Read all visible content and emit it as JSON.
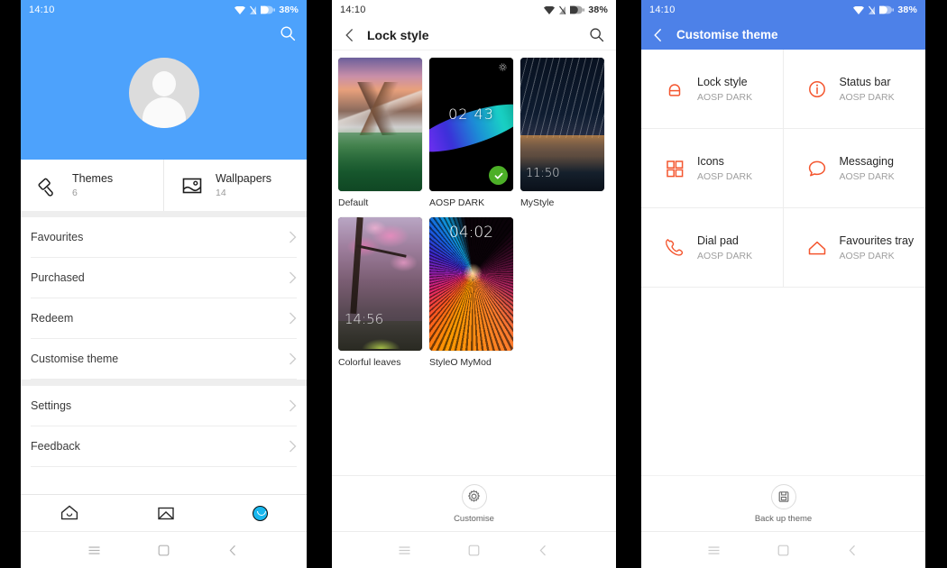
{
  "status_bar": {
    "time": "14:10",
    "battery": "38%",
    "icons": [
      "wifi-icon",
      "signal-off-icon",
      "battery-icon"
    ]
  },
  "colors": {
    "blue_header": "#4da2fc",
    "blue_appbar": "#4d81e8",
    "accent_orange": "#f4562f",
    "check_green": "#4caf27",
    "tab_active": "#18b7ee"
  },
  "phone1": {
    "search_icon": "search-icon",
    "avatar": "default-avatar",
    "quick": [
      {
        "icon": "paint-roller-icon",
        "title": "Themes",
        "count": "6"
      },
      {
        "icon": "image-icon",
        "title": "Wallpapers",
        "count": "14"
      }
    ],
    "menu_group1": [
      {
        "label": "Favourites"
      },
      {
        "label": "Purchased"
      },
      {
        "label": "Redeem"
      },
      {
        "label": "Customise theme"
      }
    ],
    "menu_group2": [
      {
        "label": "Settings"
      },
      {
        "label": "Feedback"
      }
    ],
    "tabs": [
      {
        "icon": "home-icon",
        "active": false
      },
      {
        "icon": "wallpaper-icon",
        "active": false
      },
      {
        "icon": "account-icon",
        "active": true
      }
    ]
  },
  "phone2": {
    "title": "Lock style",
    "back_icon": "back-chevron-icon",
    "search_icon": "search-icon",
    "items": [
      {
        "label": "Default",
        "art": "mountain",
        "selected": false,
        "clock": ""
      },
      {
        "label": "AOSP DARK",
        "art": "aosp",
        "selected": true,
        "clock": "02 43"
      },
      {
        "label": "MyStyle",
        "art": "startrails",
        "selected": false,
        "clock": "11:50"
      },
      {
        "label": "Colorful leaves",
        "art": "blossom",
        "selected": false,
        "clock": "14:56"
      },
      {
        "label": "StyleO MyMod",
        "art": "rays",
        "selected": false,
        "clock": "04:02"
      }
    ],
    "footer": {
      "icon": "gear-icon",
      "label": "Customise"
    }
  },
  "phone3": {
    "title": "Customise theme",
    "back_icon": "back-chevron-icon",
    "items": [
      {
        "icon": "lock-icon",
        "title": "Lock style",
        "sub": "AOSP DARK"
      },
      {
        "icon": "info-icon",
        "title": "Status bar",
        "sub": "AOSP DARK"
      },
      {
        "icon": "grid-icon",
        "title": "Icons",
        "sub": "AOSP DARK"
      },
      {
        "icon": "message-icon",
        "title": "Messaging",
        "sub": "AOSP DARK"
      },
      {
        "icon": "phone-icon",
        "title": "Dial pad",
        "sub": "AOSP DARK"
      },
      {
        "icon": "house-icon",
        "title": "Favourites tray",
        "sub": "AOSP DARK"
      }
    ],
    "footer": {
      "icon": "backup-icon",
      "label": "Back up theme"
    }
  },
  "navbar": {
    "menu_icon": "menu-icon",
    "home_icon": "square-icon",
    "back_icon": "back-chevron-icon"
  }
}
